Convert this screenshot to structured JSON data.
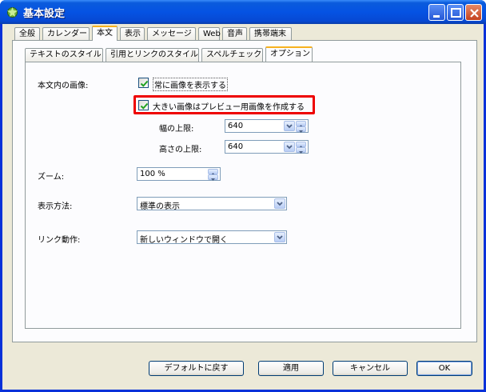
{
  "window": {
    "title": "基本設定"
  },
  "tabs_top": [
    "全般",
    "カレンダー",
    "本文",
    "表示",
    "メッセージ",
    "Web",
    "音声",
    "携帯端末"
  ],
  "tabs_inner": [
    "テキストのスタイル",
    "引用とリンクのスタイル",
    "スペルチェック",
    "オプション"
  ],
  "body_images": {
    "label": "本文内の画像:",
    "always_show": {
      "label": "常に画像を表示する",
      "checked": true
    },
    "preview": {
      "label": "大きい画像はプレビュー用画像を作成する",
      "checked": true
    },
    "width_label": "幅の上限:",
    "width_value": "640",
    "height_label": "高さの上限:",
    "height_value": "640"
  },
  "zoom": {
    "label": "ズーム:",
    "value": "100 %"
  },
  "display_method": {
    "label": "表示方法:",
    "value": "標準の表示"
  },
  "link_action": {
    "label": "リンク動作:",
    "value": "新しいウィンドウで開く"
  },
  "buttons": {
    "defaults": "デフォルトに戻す",
    "apply": "適用",
    "cancel": "キャンセル",
    "ok": "OK"
  },
  "colors": {
    "titlebar": "#0553e3",
    "highlight": "#e00000",
    "tab_accent": "#f7b21f"
  }
}
